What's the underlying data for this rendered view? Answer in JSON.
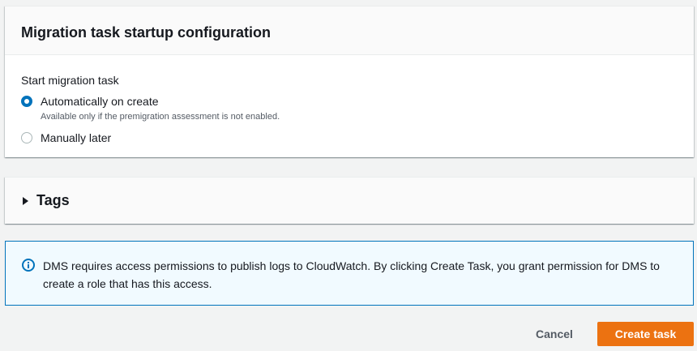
{
  "startup_panel": {
    "title": "Migration task startup configuration",
    "field_label": "Start migration task",
    "options": [
      {
        "label": "Automatically on create",
        "description": "Available only if the premigration assessment is not enabled.",
        "selected": true
      },
      {
        "label": "Manually later",
        "selected": false
      }
    ]
  },
  "tags_panel": {
    "title": "Tags",
    "expanded": false,
    "icon": "caret-right-icon"
  },
  "alert": {
    "icon": "info-icon",
    "text": "DMS requires access permissions to publish logs to CloudWatch. By clicking Create Task, you grant permission for DMS to create a role that has this access."
  },
  "actions": {
    "cancel_label": "Cancel",
    "create_label": "Create task"
  },
  "colors": {
    "primary_button": "#ec7211",
    "radio_selected": "#0073bb",
    "info_border": "#0073bb",
    "info_background": "#f1faff",
    "page_background": "#f2f3f3"
  }
}
